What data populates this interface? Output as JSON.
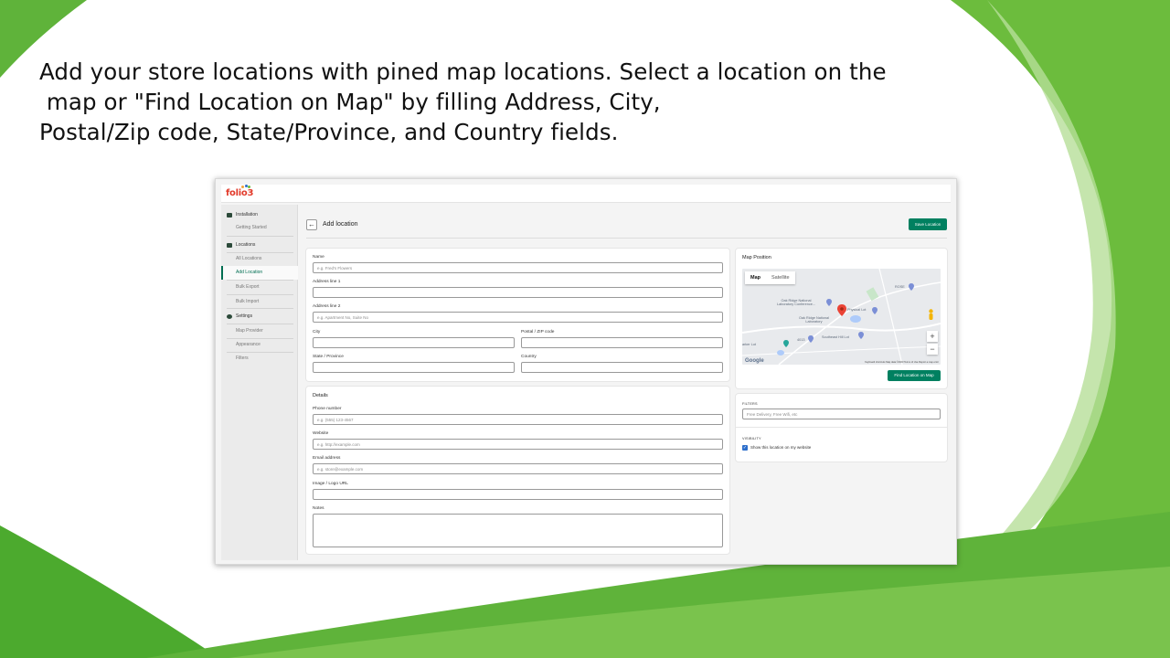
{
  "headline": {
    "line1": "Add your store locations with pined map locations. Select a location on the",
    "line2": " map or \"Find Location on Map\" by filling Address, City,",
    "line3": "Postal/Zip code, State/Province, and Country fields."
  },
  "colors": {
    "brand_green": "#008060",
    "bg_green_light": "#7cc242",
    "bg_green_dark": "#4caa2e",
    "logo_red": "#e23a2a"
  },
  "app": {
    "logo": "folio3",
    "sidebar": {
      "installation": "Installation",
      "getting_started": "Getting Started",
      "locations": "Locations",
      "all_locations": "All Locations",
      "add_location": "Add Location",
      "bulk_export": "Bulk Export",
      "bulk_import": "Bulk Import",
      "settings": "Settings",
      "map_provider": "Map Provider",
      "appearance": "Appearance",
      "filters": "Filters"
    },
    "header": {
      "back_icon": "arrow-left-icon",
      "title": "Add location",
      "save_label": "Save Location"
    },
    "form": {
      "name_label": "Name",
      "name_placeholder": "e.g. Fred's Flowers",
      "address1_label": "Address line 1",
      "address2_label": "Address line 2",
      "address2_placeholder": "e.g. Apartment No, Suite No",
      "city_label": "City",
      "postal_label": "Postal / ZIP code",
      "state_label": "State / Province",
      "country_label": "Country"
    },
    "details": {
      "title": "Details",
      "phone_label": "Phone number",
      "phone_placeholder": "e.g. (555) 123-4567",
      "website_label": "Website",
      "website_placeholder": "e.g. http://example.com",
      "email_label": "Email address",
      "email_placeholder": "e.g. store@example.com",
      "image_label": "Image / Logo URL",
      "notes_label": "Notes"
    },
    "map_card": {
      "title": "Map Position",
      "tab_map": "Map",
      "tab_satellite": "Satellite",
      "zoom_in": "+",
      "zoom_out": "−",
      "labels": {
        "oak_ridge_conf": "Oak Ridge National\nLaboratory Conference...",
        "oak_ridge_lab": "Oak Ridge National\nLaboratory",
        "physical_lot": "Physical Lot",
        "southeast_lot": "Southeast Hill Lot",
        "rose": "ROSE",
        "lot_4013": "4013",
        "parker_lot": "arker Lot",
        "google": "Google"
      },
      "attribution": "Keyboard shortcuts   Map data ©2023   Terms of Use   Report a map error",
      "find_label": "Find Location on Map"
    },
    "filters": {
      "label": "FILTERS",
      "placeholder": "Free Delivery, Free Wifi, etc"
    },
    "visibility": {
      "label": "VISIBILITY",
      "checkbox_label": "Show this location on my website",
      "checked": true
    }
  }
}
